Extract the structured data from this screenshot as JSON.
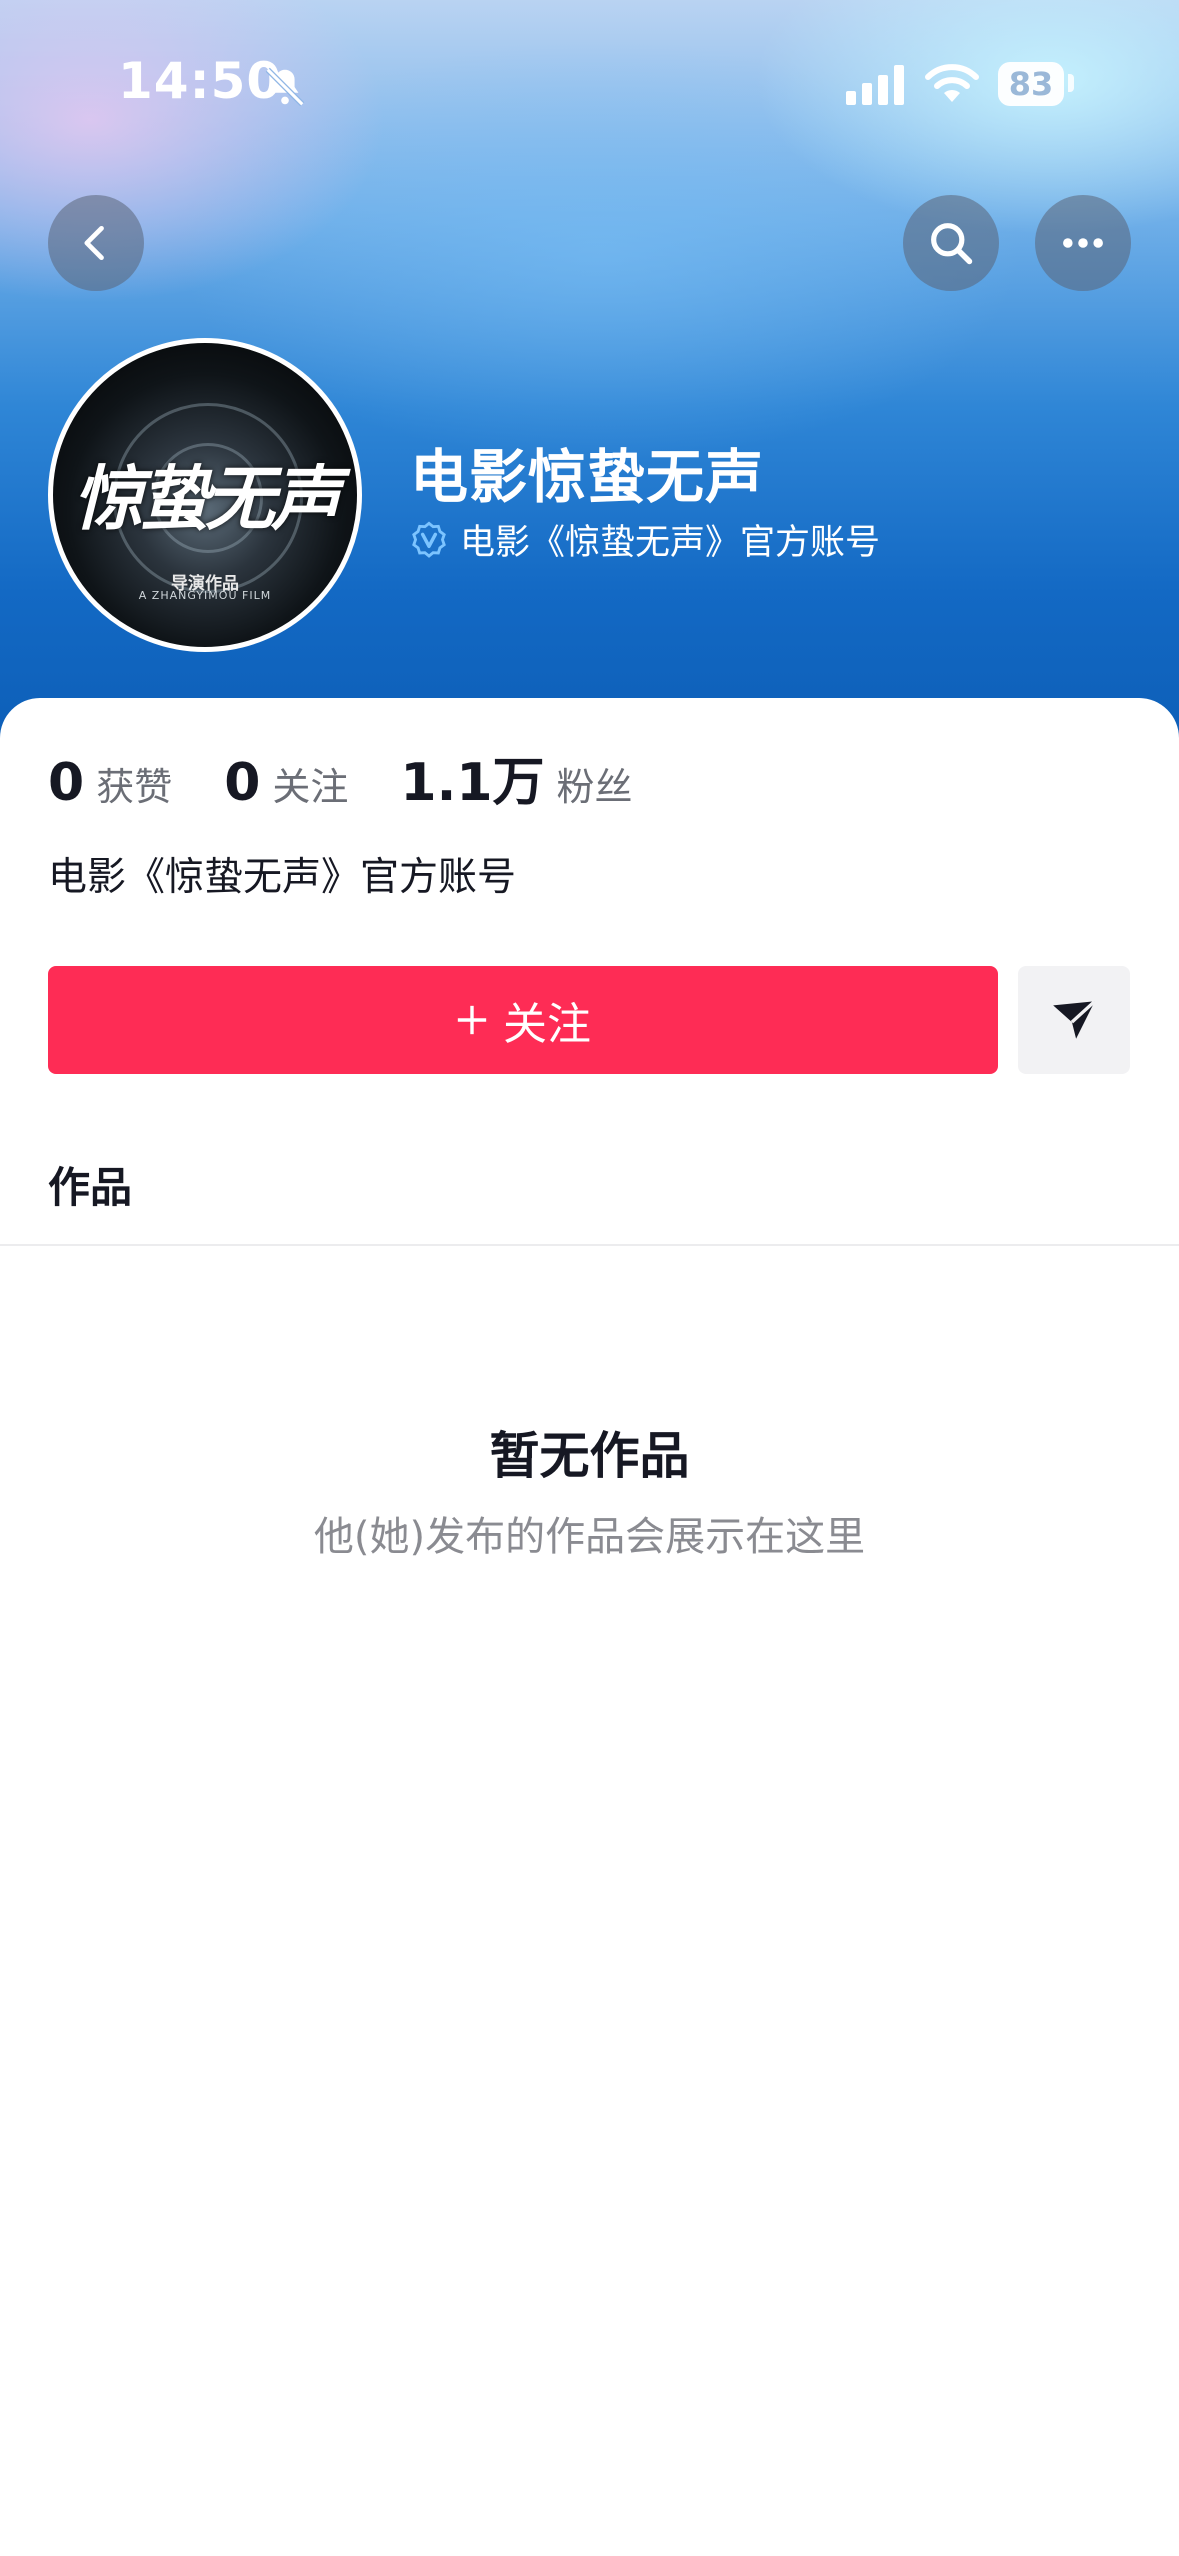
{
  "status_bar": {
    "time": "14:50",
    "battery": "83"
  },
  "profile": {
    "name": "电影惊蛰无声",
    "verification": "电影《惊蛰无声》官方账号",
    "avatar_title": "惊蛰无声",
    "avatar_director": "导演作品",
    "avatar_film": "A ZHANGYIMOU FILM"
  },
  "stats": [
    {
      "value": "0",
      "label": "获赞"
    },
    {
      "value": "0",
      "label": "关注"
    },
    {
      "value": "1.1万",
      "label": "粉丝"
    }
  ],
  "bio": "电影《惊蛰无声》官方账号",
  "actions": {
    "follow_label": "关注"
  },
  "tabs": {
    "works": "作品"
  },
  "empty_state": {
    "title": "暂无作品",
    "description": "他(她)发布的作品会展示在这里"
  },
  "colors": {
    "accent": "#fe2c55",
    "verify": "#7cc4ff"
  },
  "icons": [
    "back-icon",
    "search-icon",
    "more-icon",
    "verified-icon",
    "plus-icon",
    "share-icon",
    "bell-muted-icon",
    "signal-icon",
    "wifi-icon"
  ]
}
